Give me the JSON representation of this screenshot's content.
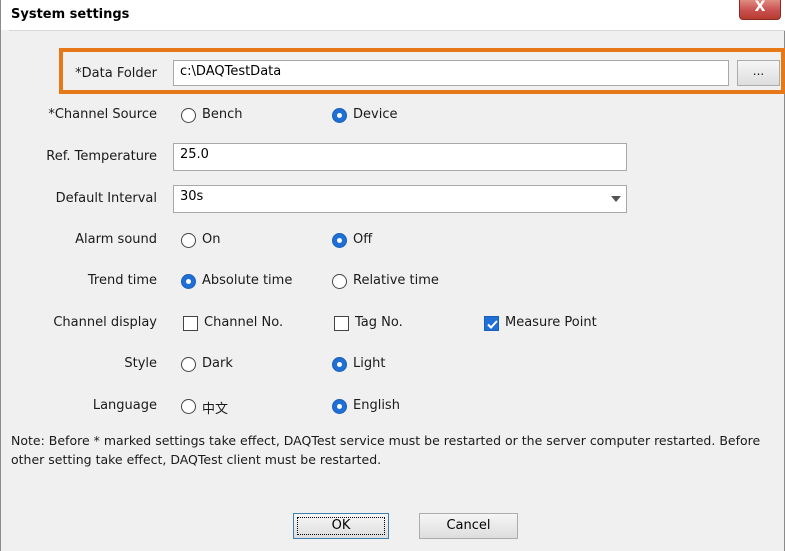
{
  "window": {
    "title": "System settings",
    "close_label": "X"
  },
  "fields": {
    "data_folder": {
      "label": "*Data Folder",
      "value": "c:\\DAQTestData",
      "browse_label": "..."
    },
    "channel_source": {
      "label": "*Channel Source",
      "options": [
        "Bench",
        "Device"
      ],
      "selected": "Device"
    },
    "ref_temperature": {
      "label": "Ref. Temperature",
      "value": "25.0"
    },
    "default_interval": {
      "label": "Default Interval",
      "value": "30s"
    },
    "alarm_sound": {
      "label": "Alarm sound",
      "options": [
        "On",
        "Off"
      ],
      "selected": "Off"
    },
    "trend_time": {
      "label": "Trend time",
      "options": [
        "Absolute time",
        "Relative time"
      ],
      "selected": "Absolute time"
    },
    "channel_display": {
      "label": "Channel display",
      "options": [
        "Channel No.",
        "Tag No.",
        "Measure Point"
      ],
      "checked": [
        "Measure Point"
      ]
    },
    "style": {
      "label": "Style",
      "options": [
        "Dark",
        "Light"
      ],
      "selected": "Light"
    },
    "language": {
      "label": "Language",
      "options": [
        "中文",
        "English"
      ],
      "selected": "English"
    }
  },
  "note": "Note: Before * marked settings take effect, DAQTest service must be restarted or the server computer restarted. Before other setting take effect, DAQTest client must be restarted.",
  "buttons": {
    "ok": "OK",
    "cancel": "Cancel"
  },
  "colors": {
    "highlight": "#e67818",
    "accent": "#1f6fd6"
  }
}
